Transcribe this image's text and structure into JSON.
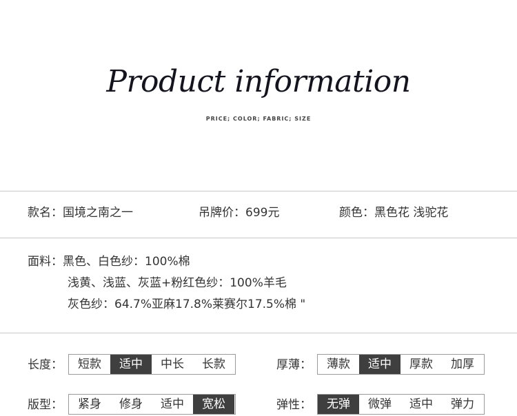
{
  "header": {
    "title": "Product information",
    "subtitle": "PRICE; COLOR; FABRIC; SIZE"
  },
  "info": {
    "name": "款名：国境之南之一",
    "price": "吊牌价：699元",
    "color": "颜色：黑色花  浅驼花"
  },
  "fabric": {
    "line1": "面料：黑色、白色纱：100%棉",
    "line2": "浅黄、浅蓝、灰蓝+粉红色纱：100%羊毛",
    "line3": "灰色纱：64.7%亚麻17.8%莱赛尔17.5%棉 \""
  },
  "attributes": {
    "length": {
      "label": "长度：",
      "options": [
        "短款",
        "适中",
        "中长",
        "长款"
      ],
      "selected": 1
    },
    "thickness": {
      "label": "厚薄：",
      "options": [
        "薄款",
        "适中",
        "厚款",
        "加厚"
      ],
      "selected": 1
    },
    "fit": {
      "label": "版型：",
      "options": [
        "紧身",
        "修身",
        "适中",
        "宽松"
      ],
      "selected": 3
    },
    "elasticity": {
      "label": "弹性：",
      "options": [
        "无弹",
        "微弹",
        "适中",
        "弹力"
      ],
      "selected": 0
    }
  }
}
